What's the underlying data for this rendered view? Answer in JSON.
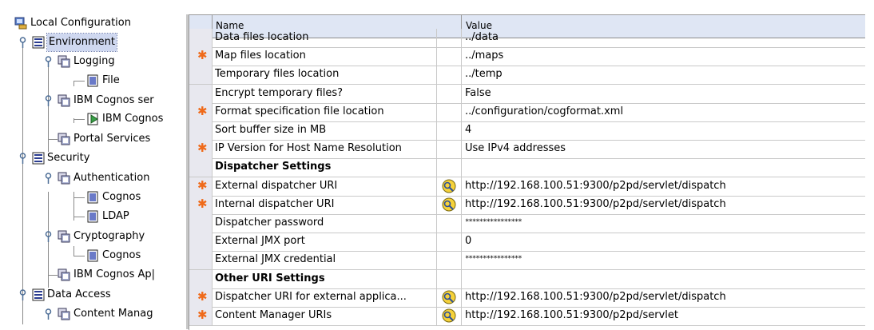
{
  "tree": {
    "root": "Local Configuration",
    "environment": "Environment",
    "logging": "Logging",
    "file": "File",
    "ibm_cognos_services": "IBM Cognos ser",
    "ibm_cognos": "IBM Cognos",
    "portal_services": "Portal Services",
    "security": "Security",
    "authentication": "Authentication",
    "auth_cognos": "Cognos",
    "auth_ldap": "LDAP",
    "cryptography": "Cryptography",
    "crypto_cognos": "Cognos",
    "ibm_cognos_app": "IBM Cognos Ap|",
    "data_access": "Data Access",
    "content_manager": "Content Manag"
  },
  "table": {
    "header_name": "Name",
    "header_value": "Value",
    "rows": [
      {
        "name": "Data files location",
        "value": "../data",
        "required": false,
        "icon": false,
        "section": false
      },
      {
        "name": "Map files location",
        "value": "../maps",
        "required": true,
        "icon": false,
        "section": false
      },
      {
        "name": "Temporary files location",
        "value": "../temp",
        "required": false,
        "icon": false,
        "section": false
      },
      {
        "name": "Encrypt temporary files?",
        "value": "False",
        "required": false,
        "icon": false,
        "section": false
      },
      {
        "name": "Format specification file location",
        "value": "../configuration/cogformat.xml",
        "required": true,
        "icon": false,
        "section": false
      },
      {
        "name": "Sort buffer size in MB",
        "value": "4",
        "required": false,
        "icon": false,
        "section": false
      },
      {
        "name": "IP Version for Host Name Resolution",
        "value": "Use IPv4 addresses",
        "required": true,
        "icon": false,
        "section": false
      },
      {
        "name": "Dispatcher Settings",
        "value": "",
        "required": false,
        "icon": false,
        "section": true
      },
      {
        "name": "External dispatcher URI",
        "value": "http://192.168.100.51:9300/p2pd/servlet/dispatch",
        "required": true,
        "icon": true,
        "section": false
      },
      {
        "name": "Internal dispatcher URI",
        "value": "http://192.168.100.51:9300/p2pd/servlet/dispatch",
        "required": true,
        "icon": true,
        "section": false
      },
      {
        "name": "Dispatcher password",
        "value": "****************",
        "required": false,
        "icon": false,
        "section": false
      },
      {
        "name": "External JMX port",
        "value": "0",
        "required": false,
        "icon": false,
        "section": false
      },
      {
        "name": "External JMX credential",
        "value": "****************",
        "required": false,
        "icon": false,
        "section": false
      },
      {
        "name": "Other URI Settings",
        "value": "",
        "required": false,
        "icon": false,
        "section": true
      },
      {
        "name": "Dispatcher URI for external applica...",
        "value": "http://192.168.100.51:9300/p2pd/servlet/dispatch",
        "required": true,
        "icon": true,
        "section": false
      },
      {
        "name": "Content Manager URIs",
        "value": "http://192.168.100.51:9300/p2pd/servlet",
        "required": true,
        "icon": true,
        "section": false
      }
    ]
  },
  "colors": {
    "required_star": "#ef6a1a",
    "header_bg": "#dfe6f4",
    "selection": "#cfd8f0"
  }
}
